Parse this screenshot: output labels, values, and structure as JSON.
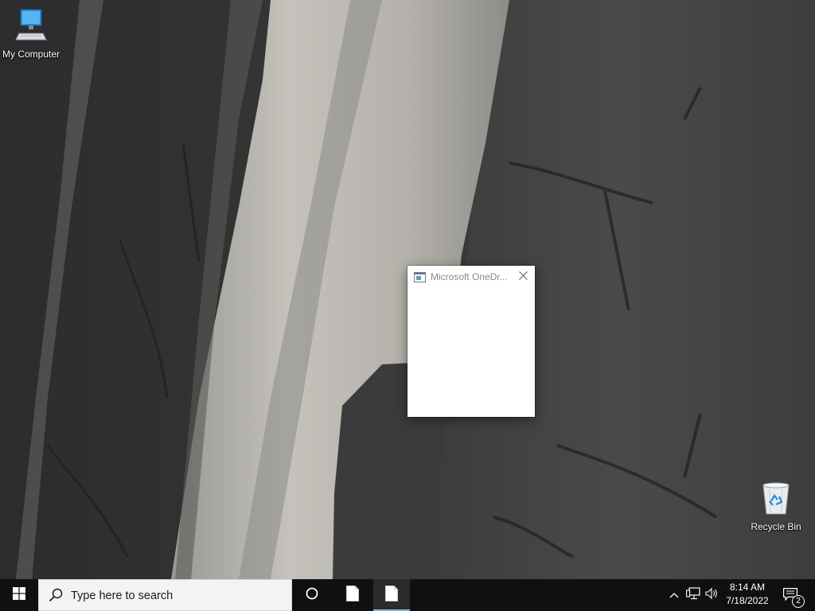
{
  "desktop": {
    "icons": [
      {
        "label": "My Computer",
        "icon": "computer-icon"
      },
      {
        "label": "Recycle Bin",
        "icon": "recycle-bin-icon"
      }
    ]
  },
  "onedrive_window": {
    "title": "Microsoft OneDr...",
    "icon": "onedrive-app-icon",
    "close_icon": "close-icon"
  },
  "taskbar": {
    "start_icon": "windows-logo-icon",
    "search_placeholder": "Type here to search",
    "search_icon": "search-icon",
    "cortana_icon": "cortana-circle-icon",
    "apps": [
      {
        "icon": "document-icon",
        "active": false
      },
      {
        "icon": "document-icon",
        "active": true
      }
    ],
    "tray": {
      "chevron_icon": "chevron-up-icon",
      "network_icon": "network-icon",
      "volume_icon": "volume-icon",
      "time": "8:14 AM",
      "date": "7/18/2022",
      "notification_icon": "notification-icon",
      "notification_count": "2"
    }
  },
  "colors": {
    "taskbar_bg": "#101010",
    "search_bg": "#f3f3f3",
    "active_indicator": "#7fb7df"
  }
}
